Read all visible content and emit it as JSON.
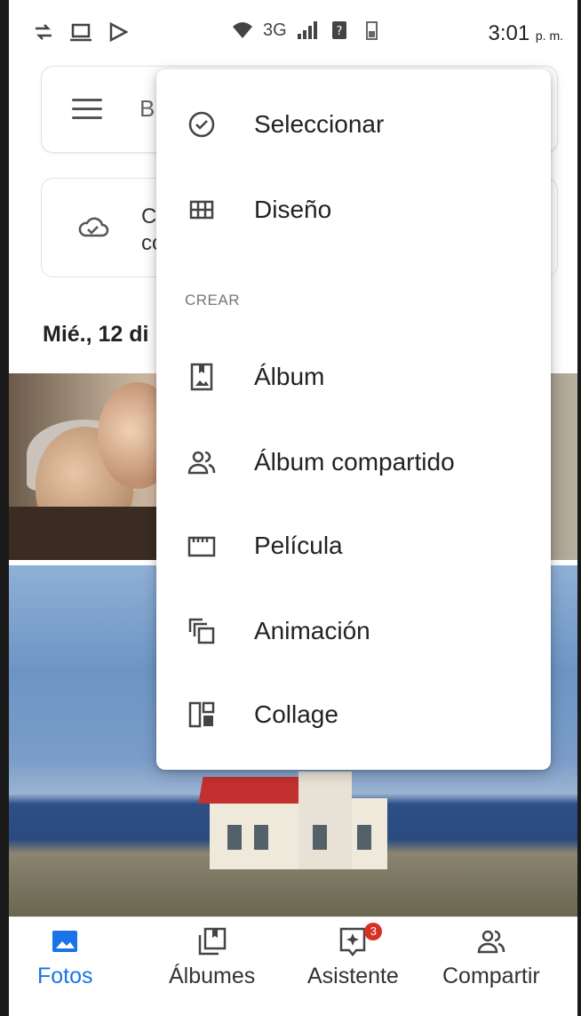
{
  "status_bar": {
    "network": "3G",
    "time": "3:01",
    "ampm": "p. m."
  },
  "search": {
    "placeholder_partial": "B"
  },
  "backup_card": {
    "line1": "C",
    "line2": "co"
  },
  "date_header": "Mié., 12 di",
  "menu": {
    "items_top": [
      {
        "label": "Seleccionar",
        "icon": "check-circle-icon"
      },
      {
        "label": "Diseño",
        "icon": "grid-layout-icon"
      }
    ],
    "section_header": "CREAR",
    "items_create": [
      {
        "label": "Álbum",
        "icon": "album-icon"
      },
      {
        "label": "Álbum compartido",
        "icon": "shared-album-icon"
      },
      {
        "label": "Película",
        "icon": "movie-icon"
      },
      {
        "label": "Animación",
        "icon": "animation-icon"
      },
      {
        "label": "Collage",
        "icon": "collage-icon"
      }
    ]
  },
  "bottom_nav": {
    "items": [
      {
        "label": "Fotos",
        "icon": "photos-icon",
        "active": true
      },
      {
        "label": "Álbumes",
        "icon": "albums-icon",
        "active": false
      },
      {
        "label": "Asistente",
        "icon": "assistant-icon",
        "active": false,
        "badge": "3"
      },
      {
        "label": "Compartir",
        "icon": "sharing-icon",
        "active": false
      }
    ]
  },
  "colors": {
    "accent": "#1a73e8",
    "badge": "#d93025"
  }
}
